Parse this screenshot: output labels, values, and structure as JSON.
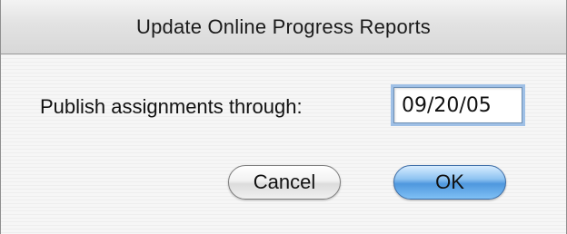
{
  "dialog": {
    "title": "Update Online Progress Reports",
    "publish_label": "Publish assignments through:",
    "publish_date": "09/20/05",
    "cancel_label": "Cancel",
    "ok_label": "OK"
  },
  "colors": {
    "default_button": "#5aa0e3",
    "focus_ring": "#9fc0e6"
  }
}
